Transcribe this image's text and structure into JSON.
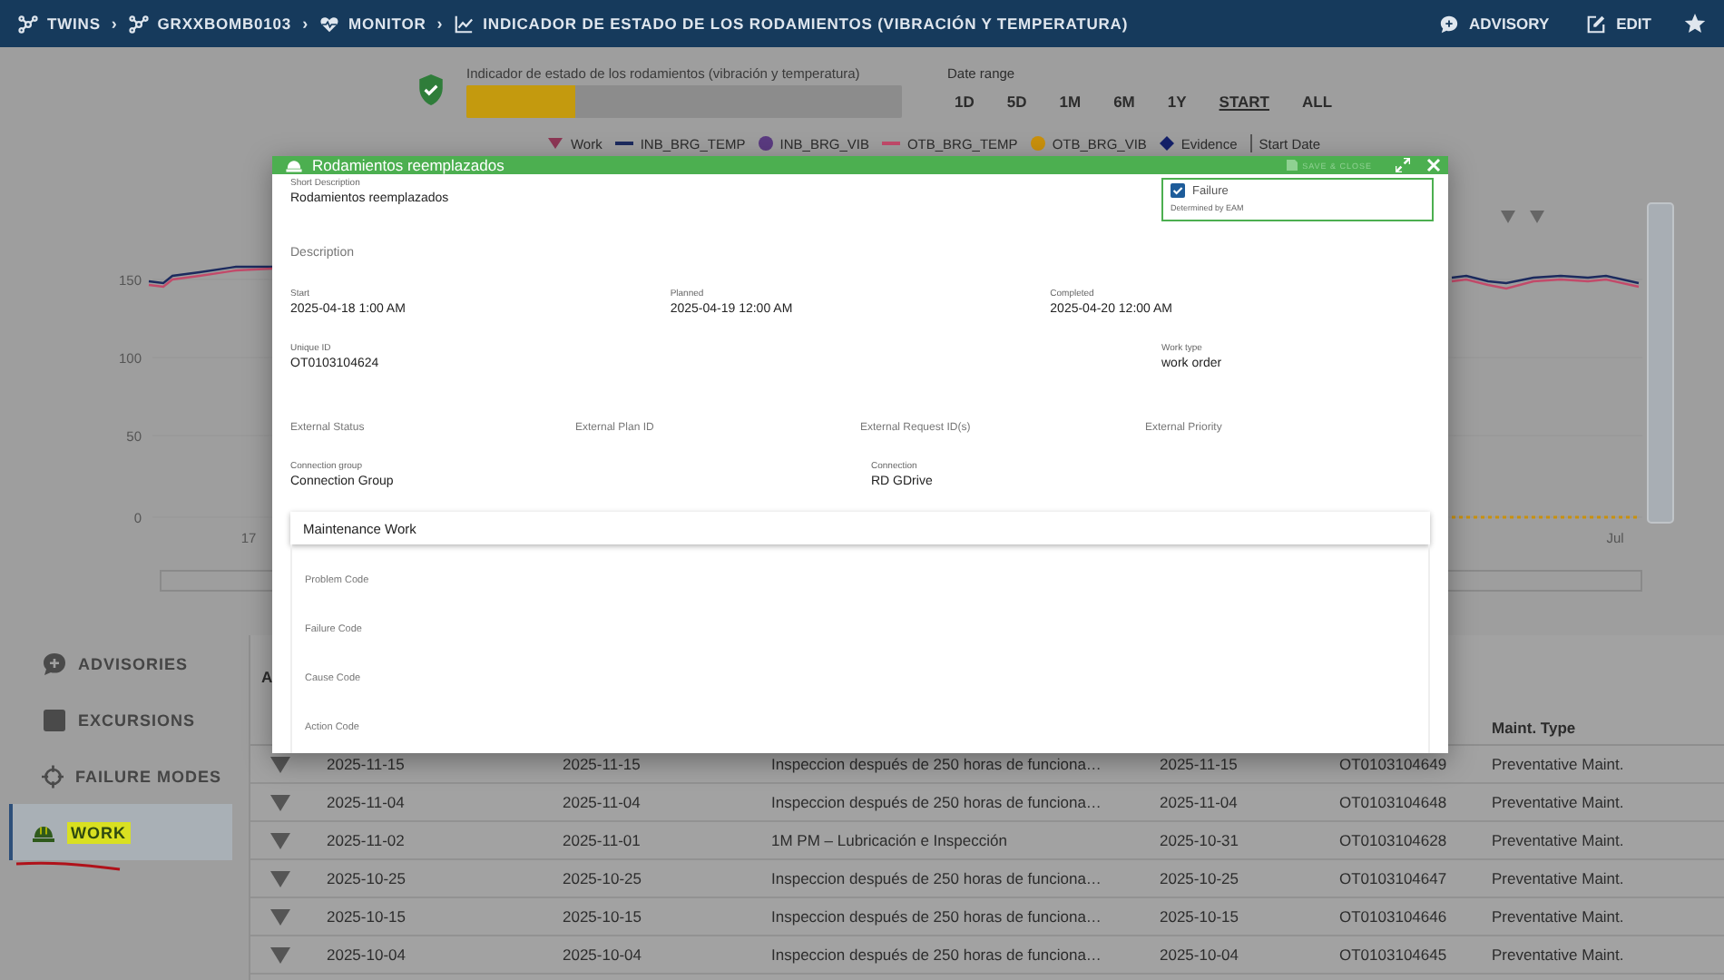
{
  "breadcrumbs": [
    {
      "label": "TWINS",
      "kind": "network"
    },
    {
      "separator": "›",
      "label": "GRXXBOMB0103",
      "kind": "network"
    },
    {
      "separator": "›",
      "label": "MONITOR",
      "kind": "heart"
    },
    {
      "separator": "›",
      "label": "INDICADOR DE ESTADO DE LOS RODAMIENTOS (VIBRACIÓN Y TEMPERATURA)",
      "kind": "chart"
    }
  ],
  "header_actions": [
    {
      "label": "ADVISORY",
      "kind": "advisory"
    },
    {
      "label": "EDIT",
      "kind": "edit"
    }
  ],
  "indicator": {
    "label": "Indicador de estado de los rodamientos (vibración y temperatura)",
    "level": 0.25
  },
  "date_range": {
    "label": "Date range",
    "options": [
      {
        "label": "1D",
        "selected": false
      },
      {
        "label": "5D",
        "selected": false
      },
      {
        "label": "1M",
        "selected": false
      },
      {
        "label": "6M",
        "selected": false
      },
      {
        "label": "1Y",
        "selected": false
      },
      {
        "label": "START",
        "selected": true
      },
      {
        "label": "ALL",
        "selected": false
      }
    ]
  },
  "legend": [
    {
      "label": "Work",
      "kind": "triangle",
      "color": "#8c3654"
    },
    {
      "label": "INB_BRG_TEMP",
      "kind": "line",
      "color": "#1c2a5e"
    },
    {
      "label": "INB_BRG_VIB",
      "kind": "circle",
      "color": "#5a3a80"
    },
    {
      "label": "OTB_BRG_TEMP",
      "kind": "line",
      "color": "#c24a6a"
    },
    {
      "label": "OTB_BRG_VIB",
      "kind": "circle",
      "color": "#c9900c"
    },
    {
      "label": "Evidence",
      "kind": "diamond",
      "color": "#14206a"
    },
    {
      "label": "Start Date",
      "kind": "separator",
      "color": "#555555"
    }
  ],
  "chart": {
    "y_ticks": [
      "150",
      "100",
      "50",
      "0"
    ],
    "x_labels": [
      "17",
      "Jul"
    ]
  },
  "sidebar": [
    {
      "label": "ADVISORIES",
      "kind": "advisory",
      "selected": false
    },
    {
      "label": "EXCURSIONS",
      "kind": "square",
      "selected": false
    },
    {
      "label": "FAILURE MODES",
      "kind": "crosshair",
      "selected": false
    },
    {
      "label": "WORK",
      "kind": "hardhat",
      "selected": true
    }
  ],
  "table": {
    "heading": "A",
    "columns": [
      "",
      "",
      "",
      "",
      "",
      "Maint. Type"
    ],
    "rows": [
      {
        "cells": [
          "2025-11-15",
          "2025-11-15",
          "Inspeccion después de 250 horas de funciona…",
          "2025-11-15",
          "OT0103104649",
          "Preventative Maint."
        ]
      },
      {
        "cells": [
          "2025-11-04",
          "2025-11-04",
          "Inspeccion después de 250 horas de funciona…",
          "2025-11-04",
          "OT0103104648",
          "Preventative Maint."
        ]
      },
      {
        "cells": [
          "2025-11-02",
          "2025-11-01",
          "1M PM – Lubricación e Inspección",
          "2025-10-31",
          "OT0103104628",
          "Preventative Maint."
        ]
      },
      {
        "cells": [
          "2025-10-25",
          "2025-10-25",
          "Inspeccion después de 250 horas de funciona…",
          "2025-10-25",
          "OT0103104647",
          "Preventative Maint."
        ]
      },
      {
        "cells": [
          "2025-10-15",
          "2025-10-15",
          "Inspeccion después de 250 horas de funciona…",
          "2025-10-15",
          "OT0103104646",
          "Preventative Maint."
        ]
      },
      {
        "cells": [
          "2025-10-04",
          "2025-10-04",
          "Inspeccion después de 250 horas de funciona…",
          "2025-10-04",
          "OT0103104645",
          "Preventative Maint."
        ]
      }
    ]
  },
  "dialog": {
    "title": "Rodamientos reemplazados",
    "save": {
      "label": "SAVE & CLOSE",
      "disabled": true
    },
    "short_description": {
      "label": "Short Description",
      "value": "Rodamientos reemplazados"
    },
    "failure": {
      "label": "Failure",
      "checked": true,
      "note": "Determined by EAM"
    },
    "description": {
      "placeholder": "Description"
    },
    "dates": [
      {
        "label": "Start",
        "value": "2025-04-18 1:00 AM"
      },
      {
        "label": "Planned",
        "value": "2025-04-19 12:00 AM"
      },
      {
        "label": "Completed",
        "value": "2025-04-20 12:00 AM"
      }
    ],
    "unique_id": {
      "label": "Unique ID",
      "value": "OT0103104624"
    },
    "work_type": {
      "label": "Work type",
      "value": "work order"
    },
    "external": [
      {
        "placeholder": "External Status"
      },
      {
        "placeholder": "External Plan ID"
      },
      {
        "placeholder": "External Request ID(s)"
      },
      {
        "placeholder": "External Priority"
      }
    ],
    "connection_group": {
      "label": "Connection group",
      "value": "Connection Group"
    },
    "connection": {
      "label": "Connection",
      "value": "RD GDrive"
    },
    "maintenance": {
      "title": "Maintenance Work",
      "codes": [
        {
          "placeholder": "Problem Code"
        },
        {
          "placeholder": "Failure Code"
        },
        {
          "placeholder": "Cause Code"
        },
        {
          "placeholder": "Action Code"
        }
      ]
    }
  }
}
